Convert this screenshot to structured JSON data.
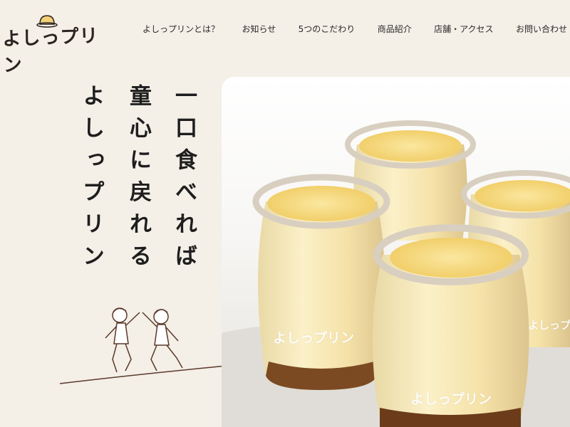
{
  "brand": {
    "logo_text": "よしっプリン"
  },
  "nav": {
    "items": [
      {
        "label": "よしっプリンとは？"
      },
      {
        "label": "お知らせ"
      },
      {
        "label": "5つのこだわり"
      },
      {
        "label": "商品紹介"
      },
      {
        "label": "店舗・アクセス"
      },
      {
        "label": "お問い合わせ"
      }
    ]
  },
  "hero": {
    "tagline_lines": [
      "一口食べれば",
      "童心に戻れる",
      "よしっプリン"
    ],
    "watermarks": [
      "よしっプリン",
      "よしっプリン",
      "よしっプリン"
    ]
  },
  "colors": {
    "background": "#f4efe7",
    "pudding": "#f6dd8a",
    "caramel": "#6b3b1a",
    "text": "#1e1e1e"
  }
}
